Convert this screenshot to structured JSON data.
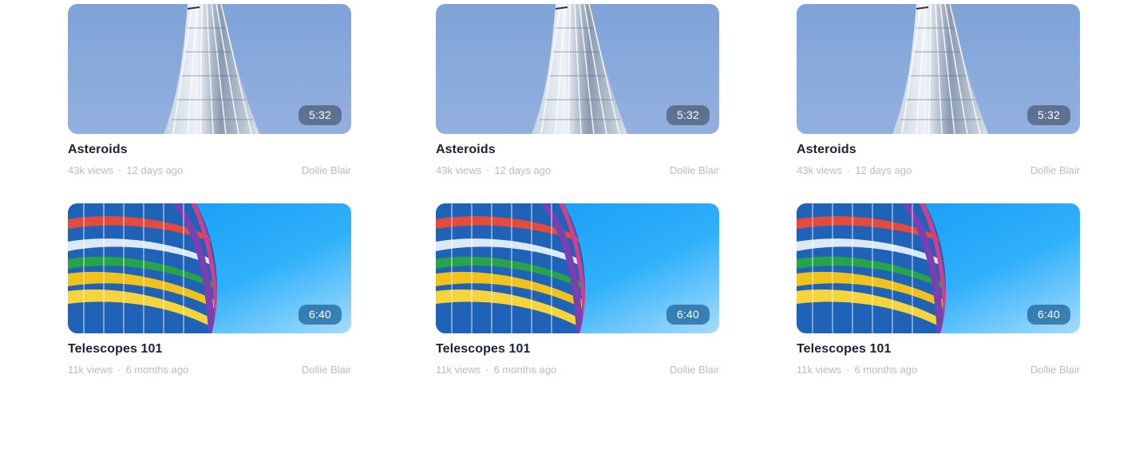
{
  "videos": [
    {
      "title": "Asteroids",
      "duration": "5:32",
      "views": "43k views",
      "separator": "·",
      "age": "12 days ago",
      "channel": "Dollie Blair",
      "thumbnail": "tower-against-sky-image"
    },
    {
      "title": "Telescopes 101",
      "duration": "6:40",
      "views": "11k views",
      "separator": "·",
      "age": "6 months ago",
      "channel": "Dollie Blair",
      "thumbnail": "colorful-curved-building-image"
    }
  ],
  "colors": {
    "sky_gray_blue": "#8aa8d9",
    "sky_bright_blue": "#1aa3f5",
    "title_text": "#1b2233",
    "meta_text": "#b8bcc4"
  }
}
